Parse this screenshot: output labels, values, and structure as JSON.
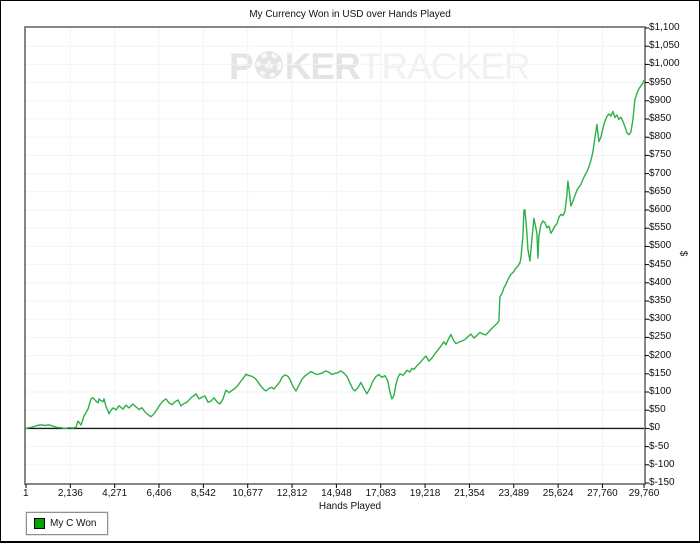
{
  "title": "My Currency Won in USD over Hands Played",
  "watermark": {
    "part1": "P",
    "part2": "KER",
    "part3": "TRACKER",
    "chip_icon": "spade-poker-chip"
  },
  "legend": {
    "label": "My C Won",
    "swatch_color": "#00a300"
  },
  "colors": {
    "line_green": "#2eb049",
    "grid": "#f3f3f3",
    "plot_border": "#868686",
    "zero_line": "#1a1a1a",
    "text": "#111111"
  },
  "chart_data": {
    "type": "line",
    "title": "My Currency Won in USD over Hands Played",
    "xlabel": "Hands Played",
    "ylabel": "$",
    "xlim": [
      1,
      29760
    ],
    "ylim": [
      -150,
      1100
    ],
    "grid": true,
    "legend_position": "bottom-left",
    "x_ticks": [
      {
        "label": "1",
        "value": 1
      },
      {
        "label": "2,136",
        "value": 2136
      },
      {
        "label": "4,271",
        "value": 4271
      },
      {
        "label": "6,406",
        "value": 6406
      },
      {
        "label": "8,542",
        "value": 8542
      },
      {
        "label": "10,677",
        "value": 10677
      },
      {
        "label": "12,812",
        "value": 12812
      },
      {
        "label": "14,948",
        "value": 14948
      },
      {
        "label": "17,083",
        "value": 17083
      },
      {
        "label": "19,218",
        "value": 19218
      },
      {
        "label": "21,354",
        "value": 21354
      },
      {
        "label": "23,489",
        "value": 23489
      },
      {
        "label": "25,624",
        "value": 25624
      },
      {
        "label": "27,760",
        "value": 27760
      },
      {
        "label": "29,760",
        "value": 29760
      }
    ],
    "y_ticks": [
      {
        "label": "$1,100",
        "value": 1100
      },
      {
        "label": "$1,050",
        "value": 1050
      },
      {
        "label": "$1,000",
        "value": 1000
      },
      {
        "label": "$950",
        "value": 950
      },
      {
        "label": "$900",
        "value": 900
      },
      {
        "label": "$850",
        "value": 850
      },
      {
        "label": "$800",
        "value": 800
      },
      {
        "label": "$750",
        "value": 750
      },
      {
        "label": "$700",
        "value": 700
      },
      {
        "label": "$650",
        "value": 650
      },
      {
        "label": "$600",
        "value": 600
      },
      {
        "label": "$550",
        "value": 550
      },
      {
        "label": "$500",
        "value": 500
      },
      {
        "label": "$450",
        "value": 450
      },
      {
        "label": "$400",
        "value": 400
      },
      {
        "label": "$350",
        "value": 350
      },
      {
        "label": "$300",
        "value": 300
      },
      {
        "label": "$250",
        "value": 250
      },
      {
        "label": "$200",
        "value": 200
      },
      {
        "label": "$150",
        "value": 150
      },
      {
        "label": "$100",
        "value": 100
      },
      {
        "label": "$50",
        "value": 50
      },
      {
        "label": "$0",
        "value": 0
      },
      {
        "label": "$-50",
        "value": -50
      },
      {
        "label": "$-100",
        "value": -100
      },
      {
        "label": "$-150",
        "value": -150
      }
    ],
    "series": [
      {
        "name": "My C Won",
        "color": "#2eb049",
        "points": [
          [
            1,
            0
          ],
          [
            145,
            2
          ],
          [
            337,
            4
          ],
          [
            530,
            8
          ],
          [
            722,
            10
          ],
          [
            915,
            8
          ],
          [
            1107,
            10
          ],
          [
            1300,
            6
          ],
          [
            1493,
            3
          ],
          [
            1685,
            2
          ],
          [
            1878,
            0
          ],
          [
            2070,
            2
          ],
          [
            2263,
            1
          ],
          [
            2408,
            3
          ],
          [
            2504,
            20
          ],
          [
            2648,
            9
          ],
          [
            2793,
            34
          ],
          [
            2985,
            53
          ],
          [
            3130,
            81
          ],
          [
            3226,
            84
          ],
          [
            3371,
            75
          ],
          [
            3467,
            70
          ],
          [
            3515,
            81
          ],
          [
            3611,
            76
          ],
          [
            3708,
            73
          ],
          [
            3756,
            81
          ],
          [
            3852,
            60
          ],
          [
            3948,
            48
          ],
          [
            3996,
            40
          ],
          [
            4093,
            50
          ],
          [
            4189,
            56
          ],
          [
            4333,
            51
          ],
          [
            4478,
            62
          ],
          [
            4671,
            53
          ],
          [
            4815,
            64
          ],
          [
            4959,
            56
          ],
          [
            5152,
            67
          ],
          [
            5297,
            59
          ],
          [
            5441,
            52
          ],
          [
            5585,
            57
          ],
          [
            5730,
            45
          ],
          [
            5874,
            38
          ],
          [
            6019,
            32
          ],
          [
            6163,
            40
          ],
          [
            6308,
            52
          ],
          [
            6452,
            65
          ],
          [
            6596,
            75
          ],
          [
            6741,
            81
          ],
          [
            6885,
            70
          ],
          [
            7030,
            65
          ],
          [
            7174,
            73
          ],
          [
            7319,
            78
          ],
          [
            7463,
            62
          ],
          [
            7607,
            68
          ],
          [
            7752,
            72
          ],
          [
            7944,
            84
          ],
          [
            8089,
            90
          ],
          [
            8185,
            95
          ],
          [
            8330,
            81
          ],
          [
            8474,
            86
          ],
          [
            8618,
            89
          ],
          [
            8763,
            72
          ],
          [
            8907,
            75
          ],
          [
            9052,
            84
          ],
          [
            9196,
            73
          ],
          [
            9341,
            67
          ],
          [
            9485,
            81
          ],
          [
            9629,
            105
          ],
          [
            9774,
            98
          ],
          [
            9918,
            104
          ],
          [
            10063,
            110
          ],
          [
            10207,
            118
          ],
          [
            10352,
            130
          ],
          [
            10496,
            140
          ],
          [
            10592,
            149
          ],
          [
            10737,
            145
          ],
          [
            10881,
            143
          ],
          [
            11026,
            138
          ],
          [
            11170,
            128
          ],
          [
            11314,
            116
          ],
          [
            11459,
            107
          ],
          [
            11555,
            103
          ],
          [
            11700,
            110
          ],
          [
            11844,
            113
          ],
          [
            11940,
            108
          ],
          [
            12085,
            118
          ],
          [
            12229,
            128
          ],
          [
            12325,
            140
          ],
          [
            12470,
            147
          ],
          [
            12614,
            143
          ],
          [
            12710,
            135
          ],
          [
            12855,
            116
          ],
          [
            12999,
            103
          ],
          [
            13143,
            118
          ],
          [
            13288,
            135
          ],
          [
            13432,
            144
          ],
          [
            13577,
            150
          ],
          [
            13721,
            156
          ],
          [
            13866,
            152
          ],
          [
            14010,
            148
          ],
          [
            14154,
            150
          ],
          [
            14299,
            153
          ],
          [
            14443,
            158
          ],
          [
            14588,
            154
          ],
          [
            14732,
            148
          ],
          [
            14877,
            151
          ],
          [
            15021,
            153
          ],
          [
            15165,
            158
          ],
          [
            15310,
            152
          ],
          [
            15454,
            143
          ],
          [
            15599,
            125
          ],
          [
            15743,
            108
          ],
          [
            15839,
            103
          ],
          [
            15984,
            112
          ],
          [
            16128,
            126
          ],
          [
            16272,
            110
          ],
          [
            16417,
            95
          ],
          [
            16561,
            110
          ],
          [
            16706,
            130
          ],
          [
            16850,
            142
          ],
          [
            16995,
            148
          ],
          [
            17139,
            140
          ],
          [
            17283,
            145
          ],
          [
            17428,
            130
          ],
          [
            17524,
            100
          ],
          [
            17620,
            81
          ],
          [
            17717,
            90
          ],
          [
            17813,
            120
          ],
          [
            17909,
            140
          ],
          [
            18006,
            150
          ],
          [
            18150,
            146
          ],
          [
            18246,
            152
          ],
          [
            18343,
            160
          ],
          [
            18487,
            155
          ],
          [
            18583,
            165
          ],
          [
            18680,
            162
          ],
          [
            18824,
            172
          ],
          [
            18969,
            180
          ],
          [
            19113,
            190
          ],
          [
            19258,
            199
          ],
          [
            19402,
            185
          ],
          [
            19547,
            193
          ],
          [
            19691,
            205
          ],
          [
            19835,
            215
          ],
          [
            19980,
            226
          ],
          [
            20124,
            238
          ],
          [
            20220,
            230
          ],
          [
            20365,
            248
          ],
          [
            20461,
            258
          ],
          [
            20606,
            240
          ],
          [
            20702,
            233
          ],
          [
            20846,
            237
          ],
          [
            20991,
            240
          ],
          [
            21135,
            244
          ],
          [
            21279,
            252
          ],
          [
            21424,
            259
          ],
          [
            21568,
            248
          ],
          [
            21713,
            255
          ],
          [
            21857,
            264
          ],
          [
            22002,
            259
          ],
          [
            22146,
            257
          ],
          [
            22290,
            266
          ],
          [
            22387,
            272
          ],
          [
            22531,
            280
          ],
          [
            22675,
            288
          ],
          [
            22772,
            295
          ],
          [
            22820,
            362
          ],
          [
            22916,
            370
          ],
          [
            23013,
            386
          ],
          [
            23109,
            396
          ],
          [
            23205,
            409
          ],
          [
            23350,
            423
          ],
          [
            23494,
            431
          ],
          [
            23590,
            440
          ],
          [
            23687,
            446
          ],
          [
            23783,
            455
          ],
          [
            23831,
            467
          ],
          [
            23927,
            528
          ],
          [
            23976,
            598
          ],
          [
            24024,
            601
          ],
          [
            24120,
            537
          ],
          [
            24168,
            492
          ],
          [
            24265,
            460
          ],
          [
            24361,
            519
          ],
          [
            24457,
            577
          ],
          [
            24554,
            550
          ],
          [
            24602,
            536
          ],
          [
            24650,
            468
          ],
          [
            24698,
            528
          ],
          [
            24794,
            560
          ],
          [
            24891,
            570
          ],
          [
            24987,
            565
          ],
          [
            25083,
            551
          ],
          [
            25180,
            556
          ],
          [
            25276,
            536
          ],
          [
            25372,
            545
          ],
          [
            25469,
            556
          ],
          [
            25565,
            562
          ],
          [
            25661,
            580
          ],
          [
            25758,
            588
          ],
          [
            25854,
            585
          ],
          [
            25950,
            596
          ],
          [
            26047,
            640
          ],
          [
            26095,
            679
          ],
          [
            26143,
            660
          ],
          [
            26239,
            611
          ],
          [
            26336,
            624
          ],
          [
            26432,
            639
          ],
          [
            26528,
            654
          ],
          [
            26625,
            663
          ],
          [
            26721,
            670
          ],
          [
            26817,
            684
          ],
          [
            26914,
            695
          ],
          [
            27010,
            705
          ],
          [
            27106,
            719
          ],
          [
            27203,
            736
          ],
          [
            27299,
            760
          ],
          [
            27395,
            798
          ],
          [
            27492,
            835
          ],
          [
            27588,
            788
          ],
          [
            27684,
            800
          ],
          [
            27780,
            824
          ],
          [
            27877,
            844
          ],
          [
            27973,
            857
          ],
          [
            28069,
            864
          ],
          [
            28166,
            858
          ],
          [
            28262,
            871
          ],
          [
            28358,
            854
          ],
          [
            28455,
            861
          ],
          [
            28551,
            849
          ],
          [
            28647,
            855
          ],
          [
            28744,
            844
          ],
          [
            28840,
            829
          ],
          [
            28936,
            812
          ],
          [
            29033,
            807
          ],
          [
            29129,
            814
          ],
          [
            29225,
            848
          ],
          [
            29322,
            903
          ],
          [
            29418,
            920
          ],
          [
            29514,
            933
          ],
          [
            29611,
            941
          ],
          [
            29707,
            948
          ],
          [
            29755,
            956
          ]
        ]
      }
    ]
  }
}
